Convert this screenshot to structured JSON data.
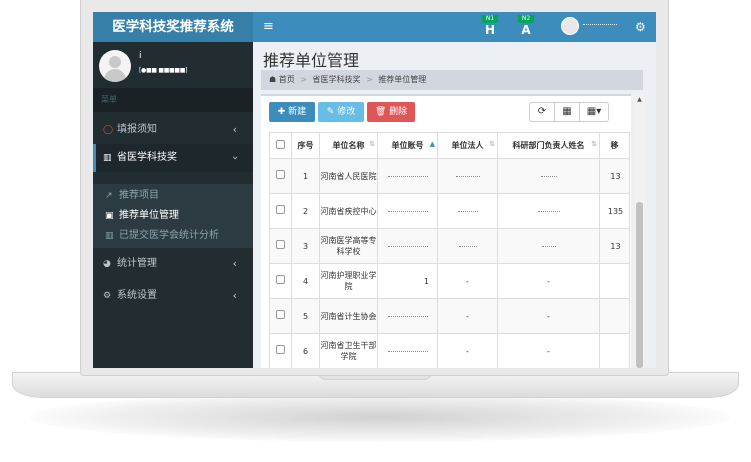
{
  "app": {
    "title": "医学科技奖推荐系统"
  },
  "navbar": {
    "toggle_icon": "≡",
    "icons": [
      {
        "name": "h-notification-icon",
        "badge": "N1",
        "glyph": "H"
      },
      {
        "name": "a-notification-icon",
        "badge": "N2",
        "glyph": "A"
      }
    ],
    "settings_icon": "gear-icon"
  },
  "sidebar": {
    "user": {
      "name": "i",
      "status": "[●■■ ■■■■■]"
    },
    "header": "菜单",
    "items": [
      {
        "icon": "circle-icon",
        "glyph": "◯",
        "label": "填报须知",
        "chevron": "‹"
      },
      {
        "icon": "bar-chart-icon",
        "glyph": "▥",
        "label": "省医学科技奖",
        "chevron": "›"
      },
      {
        "icon": "pie-chart-icon",
        "glyph": "◕",
        "label": "统计管理",
        "chevron": "‹"
      },
      {
        "icon": "cogs-icon",
        "glyph": "⚙",
        "label": "系统设置",
        "chevron": "‹"
      }
    ],
    "subitems": [
      {
        "icon": "line-chart-icon",
        "glyph": "↗",
        "label": "推荐项目"
      },
      {
        "icon": "id-card-icon",
        "glyph": "▣",
        "label": "推荐单位管理"
      },
      {
        "icon": "bar-chart-icon",
        "glyph": "▥",
        "label": "已提交医学会统计分析"
      }
    ]
  },
  "content": {
    "title": "推荐单位管理",
    "breadcrumb": {
      "home": "首页",
      "level2": "省医学科技奖",
      "level3": "推荐单位管理",
      "sep": ">"
    }
  },
  "toolbar": {
    "add_label": "✚ 新建",
    "edit_label": "✎ 修改",
    "delete_label": "🗑 删除",
    "refresh_icon": "⟳",
    "columns_icon": "▦",
    "grid_icon": "▦▾"
  },
  "table": {
    "headers": [
      "序号",
      "单位名称",
      "单位账号",
      "单位法人",
      "科研部门负责人姓名",
      "移"
    ],
    "rows": [
      {
        "no": "1",
        "name": "河南省人民医院",
        "account": "",
        "legal": "",
        "head": "",
        "phone": "13"
      },
      {
        "no": "2",
        "name": "河南省疾控中心",
        "account": "",
        "legal": "",
        "head": "",
        "phone": "135"
      },
      {
        "no": "3",
        "name": "河南医学高等专科学校",
        "account": "",
        "legal": "",
        "head": "",
        "phone": "13"
      },
      {
        "no": "4",
        "name": "河南护理职业学院",
        "account": "1",
        "legal": "-",
        "head": "-",
        "phone": ""
      },
      {
        "no": "5",
        "name": "河南省计生协会",
        "account": "",
        "legal": "-",
        "head": "-",
        "phone": ""
      },
      {
        "no": "6",
        "name": "河南省卫生干部学院",
        "account": "",
        "legal": "-",
        "head": "-",
        "phone": ""
      }
    ]
  }
}
